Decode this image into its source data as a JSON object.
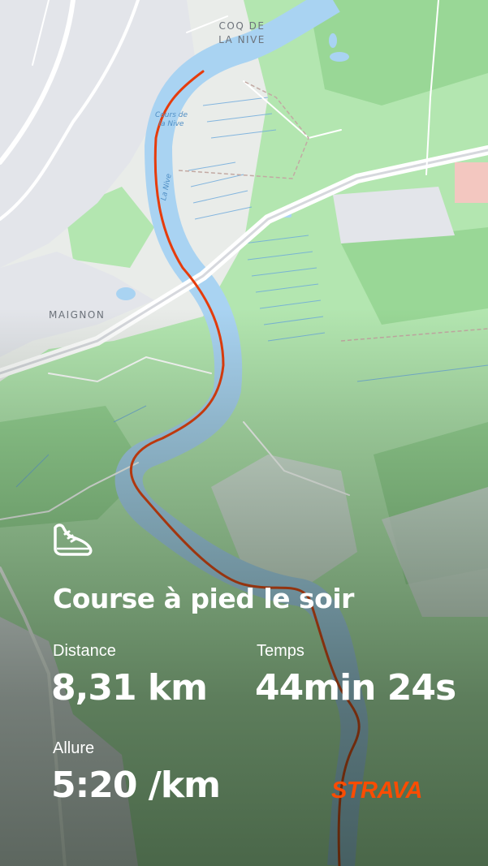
{
  "map": {
    "place_labels": [
      {
        "key": "coq",
        "text": "COQ DE\nLA NIVE"
      },
      {
        "key": "maignon",
        "text": "MAIGNON"
      }
    ],
    "water_labels": {
      "cours": "Cours de\nla Nive",
      "river": "La Nive"
    },
    "colors": {
      "forest": "#b3e6b0",
      "urban": "#e5e7ec",
      "water": "#a9d3f2",
      "route": "#e63c0c"
    }
  },
  "activity": {
    "icon": "running-shoe-icon",
    "title": "Course à pied le soir",
    "stats": {
      "distance": {
        "label": "Distance",
        "value": "8,31 km"
      },
      "time": {
        "label": "Temps",
        "value": "44min 24s"
      },
      "pace": {
        "label": "Allure",
        "value": "5:20 /km"
      }
    }
  },
  "brand": {
    "logo": "STRAVA",
    "color": "#fc4c02"
  }
}
